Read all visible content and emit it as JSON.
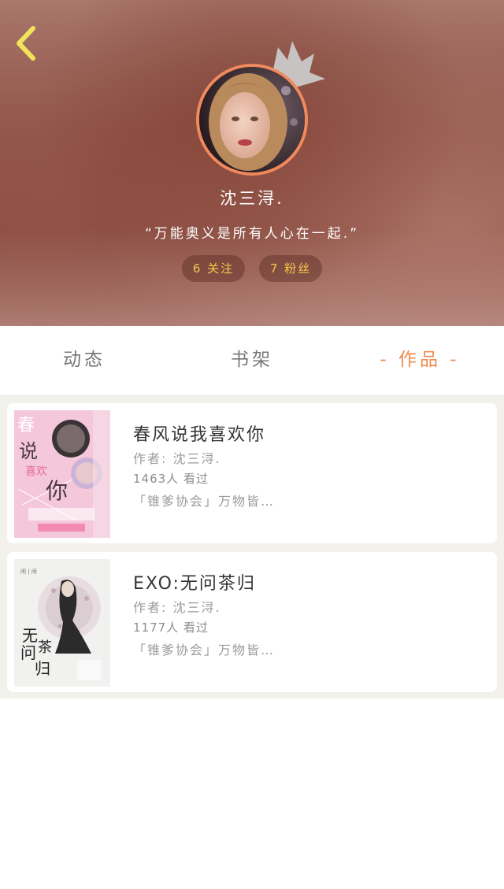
{
  "profile": {
    "username": "沈三浔.",
    "motto": "“万能奥义是所有人心在一起.”",
    "following": "6 关注",
    "fans": "7 粉丝"
  },
  "icons": {
    "back": "chevron-left-icon",
    "crown": "crown-icon"
  },
  "colors": {
    "accent": "#f08a4e",
    "stat_text": "#f6c84a",
    "avatar_border": "#f08a5d"
  },
  "tabs": [
    {
      "label": "动态",
      "active": false
    },
    {
      "label": "书架",
      "active": false
    },
    {
      "label": "- 作品 -",
      "active": true
    }
  ],
  "works": [
    {
      "title": "春风说我喜欢你",
      "author": "作者: 沈三浔.",
      "views": "1463人 看过",
      "desc": "「锥爹协会」万物皆…",
      "cover_text": "春风说我喜欢你"
    },
    {
      "title": "EXO:无问茶归",
      "author": "作者: 沈三浔.",
      "views": "1177人 看过",
      "desc": "「锥爹协会」万物皆…",
      "cover_text": "无问茶归"
    }
  ]
}
